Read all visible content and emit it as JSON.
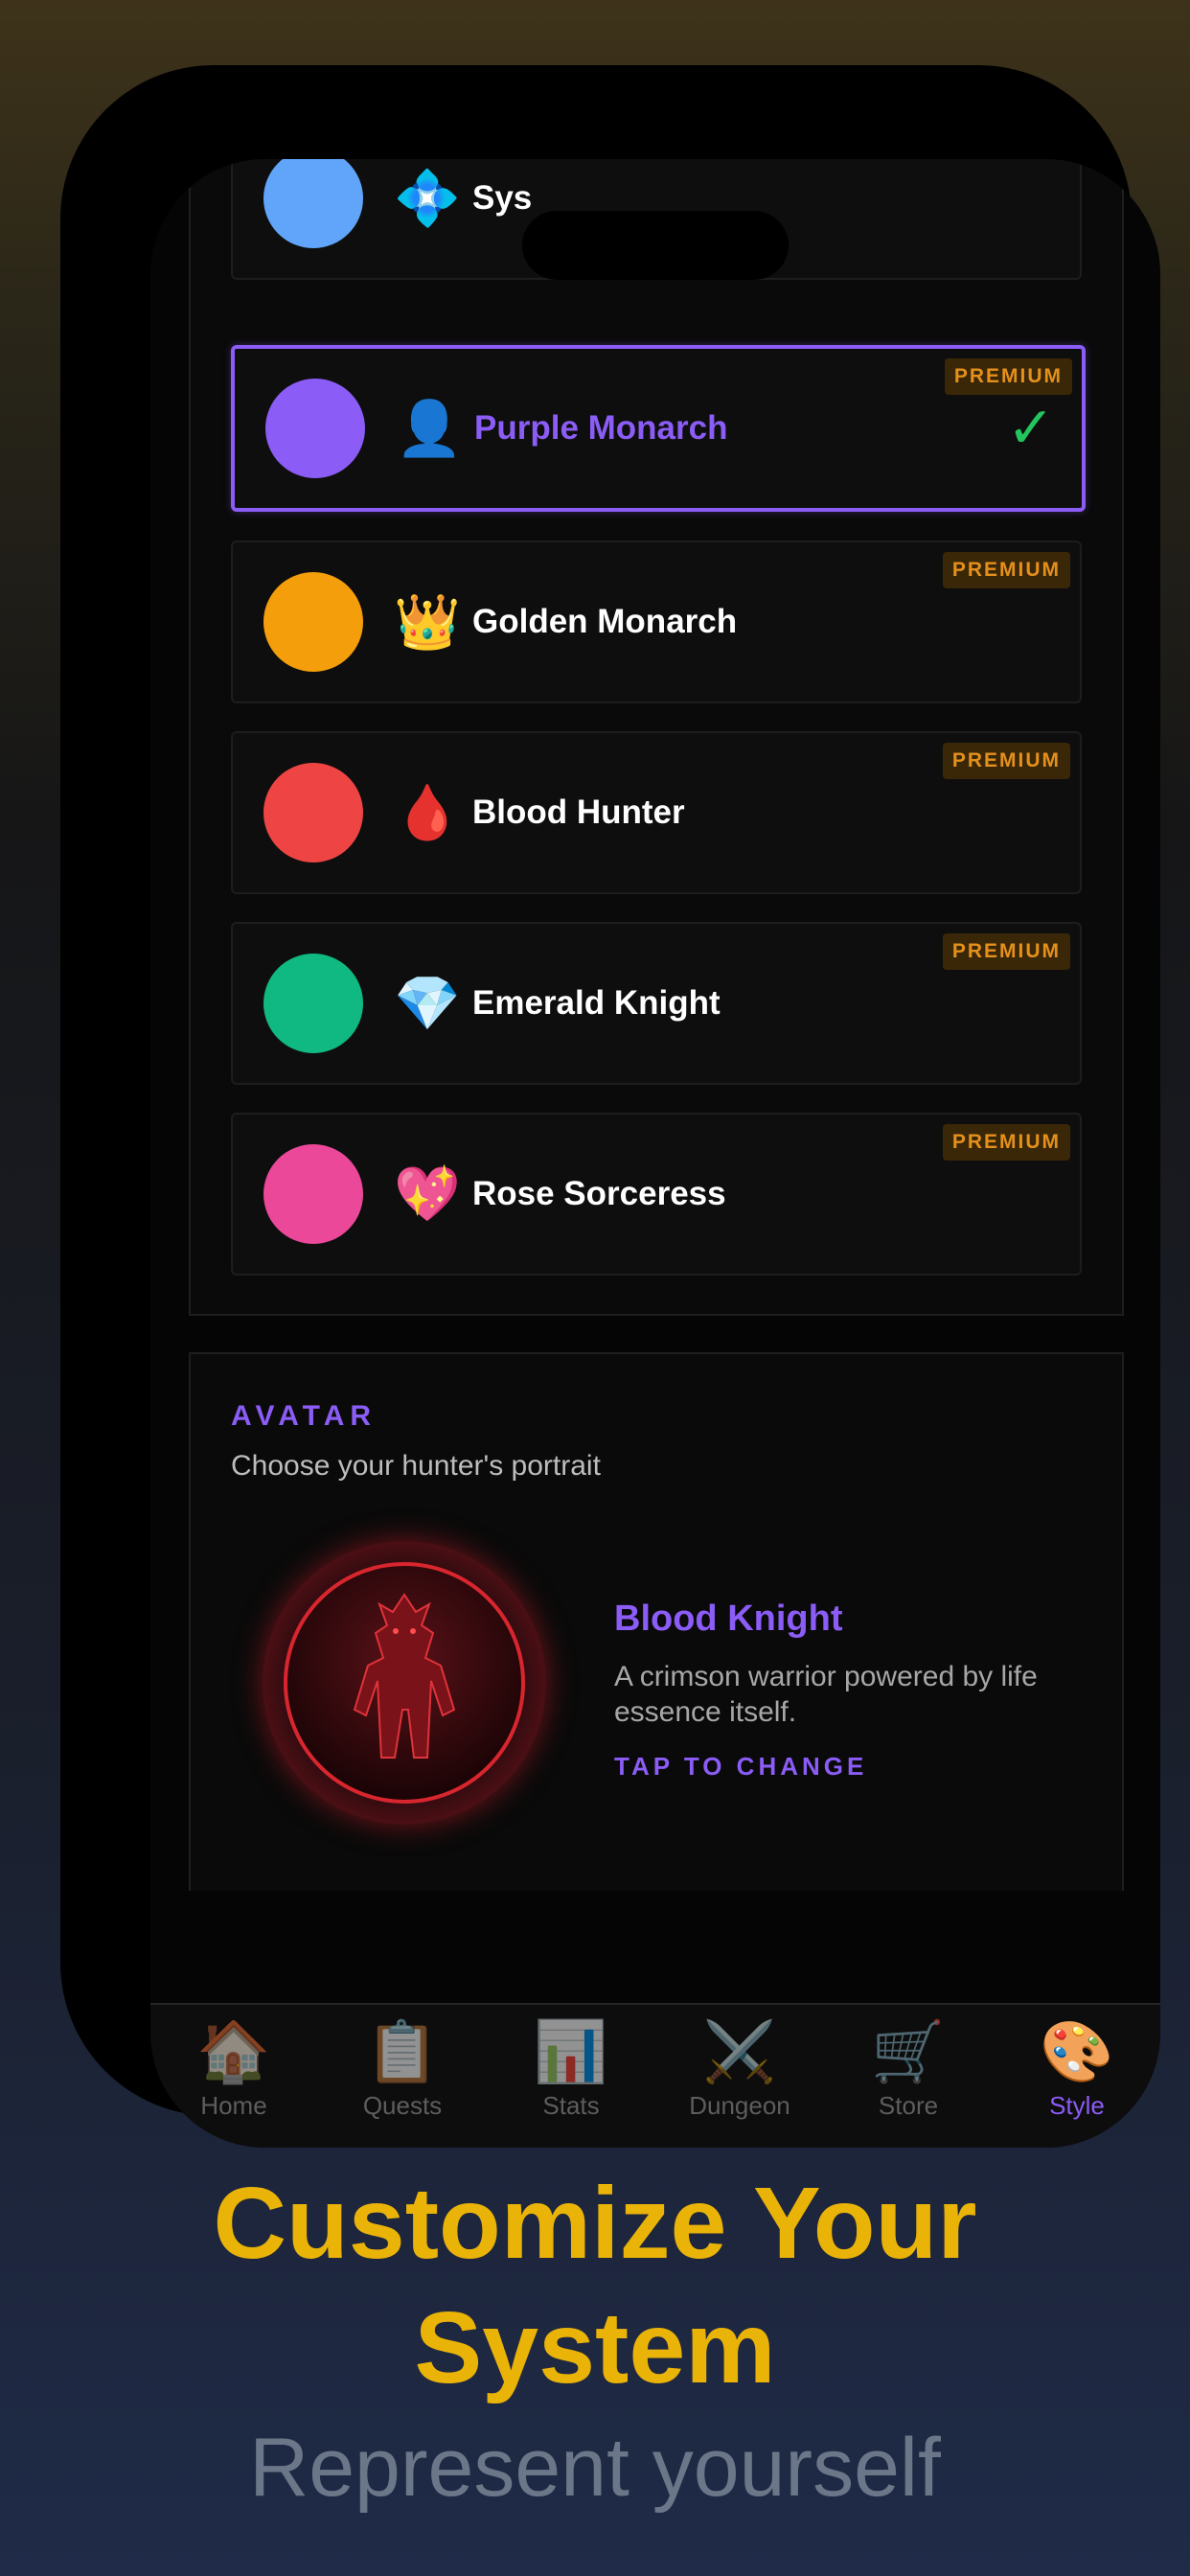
{
  "themes": [
    {
      "name": "Sys",
      "emoji": "💠",
      "color": "#60a5fa",
      "premium": "",
      "selected": false
    },
    {
      "name": "Purple Monarch",
      "emoji": "👤",
      "color": "#8b5cf6",
      "premium": "PREMIUM",
      "selected": true,
      "check": "✓"
    },
    {
      "name": "Golden Monarch",
      "emoji": "👑",
      "color": "#f59e0b",
      "premium": "PREMIUM",
      "selected": false
    },
    {
      "name": "Blood Hunter",
      "emoji": "🩸",
      "color": "#ef4444",
      "premium": "PREMIUM",
      "selected": false
    },
    {
      "name": "Emerald Knight",
      "emoji": "💎",
      "color": "#10b981",
      "premium": "PREMIUM",
      "selected": false
    },
    {
      "name": "Rose Sorceress",
      "emoji": "💖",
      "color": "#ec4899",
      "premium": "PREMIUM",
      "selected": false
    }
  ],
  "avatar": {
    "title": "AVATAR",
    "subtitle": "Choose your hunter's portrait",
    "name": "Blood Knight",
    "description": "A crimson warrior powered by life essence itself.",
    "action": "TAP TO CHANGE"
  },
  "tabs": [
    {
      "label": "Home",
      "icon": "🏠",
      "icon_name": "home-icon"
    },
    {
      "label": "Quests",
      "icon": "📋",
      "icon_name": "clipboard-icon"
    },
    {
      "label": "Stats",
      "icon": "📊",
      "icon_name": "bar-chart-icon"
    },
    {
      "label": "Dungeon",
      "icon": "⚔️",
      "icon_name": "crossed-swords-icon"
    },
    {
      "label": "Store",
      "icon": "🛒",
      "icon_name": "shopping-cart-icon"
    },
    {
      "label": "Style",
      "icon": "🎨",
      "icon_name": "palette-icon",
      "active": true
    }
  ],
  "promo": {
    "headline_line1": "Customize Your",
    "headline_line2": "System",
    "tagline": "Represent yourself"
  },
  "colors": {
    "accent": "#8b5cf6",
    "premium": "#e4901b",
    "headline": "#eab308",
    "check": "#22c55e"
  }
}
